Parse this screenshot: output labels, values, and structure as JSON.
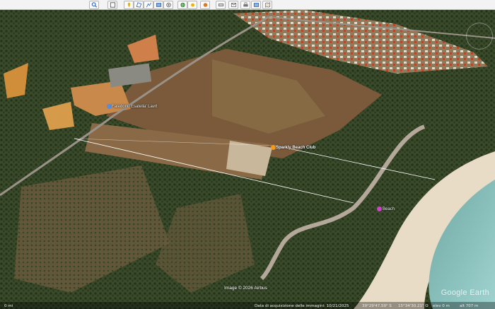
{
  "toolbar": {
    "buttons": [
      {
        "icon": "search-icon"
      },
      {
        "icon": "square-icon"
      },
      {
        "icon": "pin-icon"
      },
      {
        "icon": "polygon-icon"
      },
      {
        "icon": "path-icon"
      },
      {
        "icon": "overlay-icon"
      },
      {
        "icon": "tour-icon"
      },
      {
        "icon": "globe-icon"
      },
      {
        "icon": "sun-icon"
      },
      {
        "icon": "planet-icon"
      },
      {
        "icon": "ruler-icon"
      },
      {
        "icon": "email-icon"
      },
      {
        "icon": "print-icon"
      },
      {
        "icon": "save-image-icon"
      },
      {
        "icon": "maps-icon"
      }
    ]
  },
  "map": {
    "places": [
      {
        "label": "Fatedoriu Esatella' Lavrt",
        "kind": "road"
      },
      {
        "label": "Sparkly Beach Club",
        "kind": "venue"
      },
      {
        "label": "Beach",
        "kind": "venue"
      }
    ],
    "attribution": "Image © 2026 Airbus",
    "watermark": "Google Earth"
  },
  "status": {
    "acquisition": "Data di acquisizione delle immagini: 10/21/2025",
    "lat": "39°29'47.59\" S",
    "lon": "15°34'30.21\" O",
    "elev": "elev  0 m",
    "alt": "alt  707 m",
    "scale": "0 mi"
  },
  "colors": {
    "accent": "#cc44cc",
    "pin": "#f39a1a"
  }
}
